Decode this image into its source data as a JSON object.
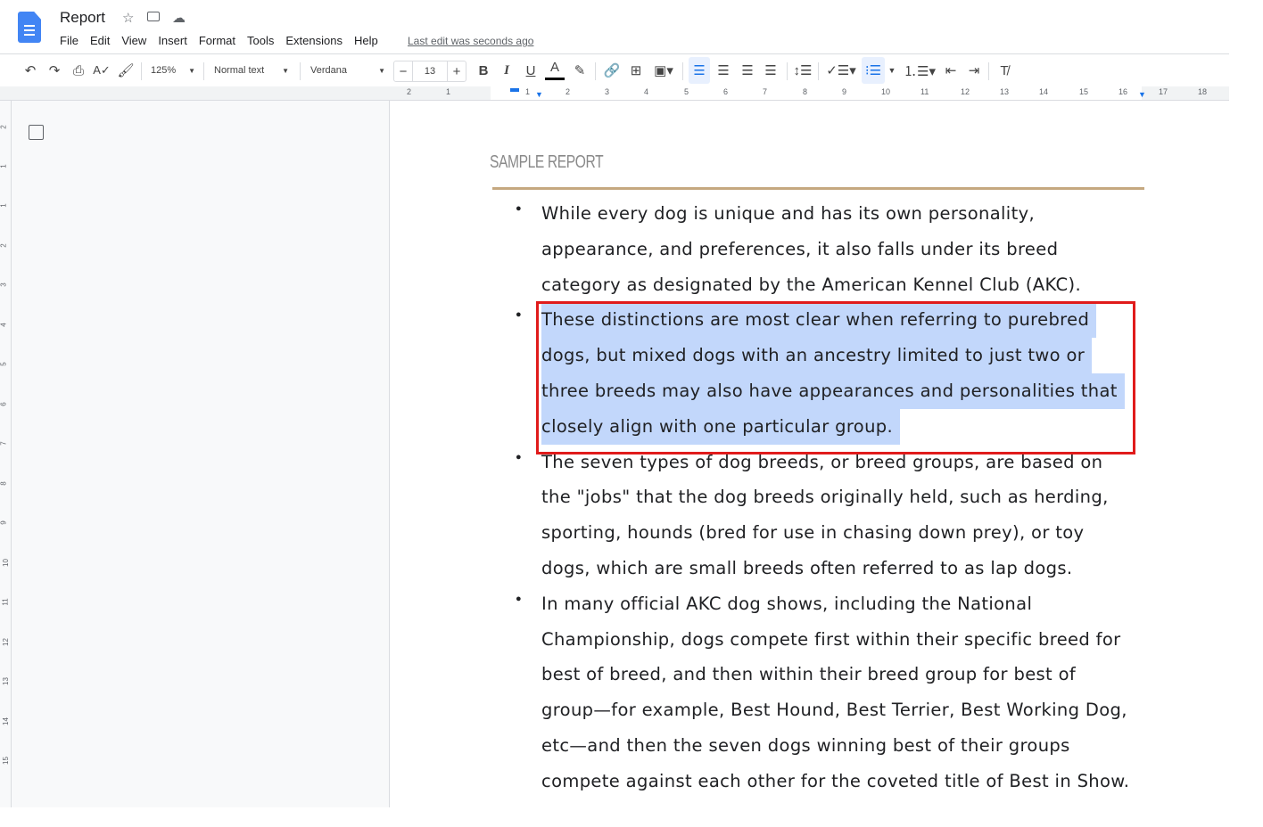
{
  "app": {
    "title": "Report",
    "icons": [
      "star-icon",
      "move-to-folder-icon",
      "cloud-saved-icon"
    ],
    "brand_color": "#4285f4"
  },
  "menu": [
    "File",
    "Edit",
    "View",
    "Insert",
    "Format",
    "Tools",
    "Extensions",
    "Help"
  ],
  "last_edit": "Last edit was seconds ago",
  "toolbar": {
    "zoom": "125%",
    "style": "Normal text",
    "font": "Verdana",
    "font_size": "13",
    "minus": "−",
    "plus": "+",
    "bold": "B",
    "italic": "I",
    "underline": "U",
    "text_color": "A",
    "active_alignment": "left",
    "active_list": "bulleted"
  },
  "ruler": {
    "h_labels": [
      "2",
      "1",
      "1",
      "2",
      "3",
      "4",
      "5",
      "6",
      "7",
      "8",
      "9",
      "10",
      "11",
      "12",
      "13",
      "14",
      "15",
      "16",
      "17",
      "18"
    ],
    "v_labels": [
      "2",
      "1",
      "1",
      "2",
      "3",
      "4",
      "5",
      "6",
      "7",
      "8",
      "9",
      "10",
      "11",
      "12",
      "13",
      "14",
      "15"
    ]
  },
  "document": {
    "heading": "SAMPLE REPORT",
    "rule_color": "#c5a880",
    "bullets": [
      {
        "lines": [
          "While every dog is unique and has its own personality,",
          "appearance, and preferences, it also falls under its breed",
          "category as designated by the American Kennel Club (AKC)."
        ],
        "selected": false
      },
      {
        "lines": [
          "These distinctions are most clear when referring to purebred",
          "dogs, but mixed dogs with an ancestry limited to just two or",
          "three breeds may also have appearances and personalities that",
          "closely align with one particular group."
        ],
        "selected": true
      },
      {
        "lines": [
          "The seven types of dog breeds, or breed groups, are based on",
          "the \"jobs\" that the dog breeds originally held, such as herding,",
          "sporting, hounds (bred for use in chasing down prey), or toy",
          "dogs, which are small breeds often referred to as lap dogs."
        ],
        "selected": false
      },
      {
        "lines": [
          "In many official AKC dog shows, including the National",
          "Championship, dogs compete first within their specific breed for",
          "best of breed, and then within their breed group for best of",
          "group—for example, Best Hound, Best Terrier, Best Working Dog,",
          "etc—and then the seven dogs winning best of their groups",
          "compete against each other for the coveted title of Best in Show."
        ],
        "selected": false
      }
    ],
    "highlight_box_color": "#e01b1b",
    "selection_color": "#c2d7fb"
  }
}
